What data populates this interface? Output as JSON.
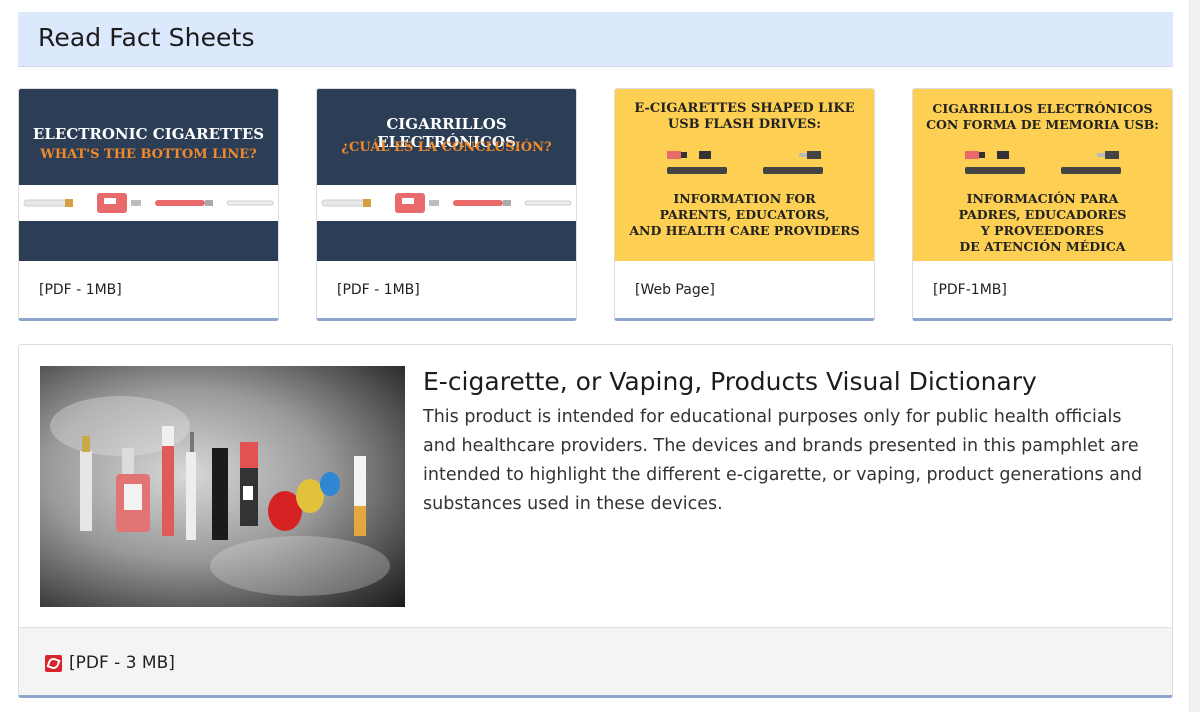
{
  "section": {
    "title": "Read Fact Sheets"
  },
  "cards": [
    {
      "title_line1": "ELECTRONIC CIGARETTES",
      "title_line2": "WHAT'S THE BOTTOM LINE?",
      "meta": "[PDF - 1MB]"
    },
    {
      "title_line1": "CIGARRILLOS ELECTRÓNICOS",
      "title_line2": "¿CUÁL ES LA CONCLUSIÓN?",
      "meta": "[PDF - 1MB]"
    },
    {
      "title_lines": [
        "E-CIGARETTES SHAPED LIKE",
        "USB FLASH DRIVES:"
      ],
      "sub_lines": [
        "INFORMATION FOR",
        "PARENTS, EDUCATORS,",
        "AND HEALTH CARE PROVIDERS"
      ],
      "meta": "[Web Page]"
    },
    {
      "title_lines": [
        "CIGARRILLOS ELECTRÓNICOS",
        "CON FORMA DE MEMORIA USB:"
      ],
      "sub_lines": [
        "INFORMACIÓN PARA",
        "PADRES, EDUCADORES",
        "Y PROVEEDORES",
        "DE ATENCIÓN MÉDICA"
      ],
      "meta": "[PDF-1MB]"
    }
  ],
  "dictionary": {
    "title": "E-cigarette, or Vaping, Products Visual Dictionary",
    "description": "This product is intended for educational purposes only for public health officials and healthcare providers. The devices and brands presented in this pamphlet are intended to highlight the different e-cigarette, or vaping, product generations and substances used in these devices.",
    "link": "[PDF - 3 MB]"
  },
  "colors": {
    "header_bg": "#dce8fb",
    "navy": "#2c3e55",
    "orange": "#f08a2b",
    "yellow": "#fdcf52",
    "card_accent": "#8ea5cf",
    "pdf_red": "#d9232d"
  }
}
